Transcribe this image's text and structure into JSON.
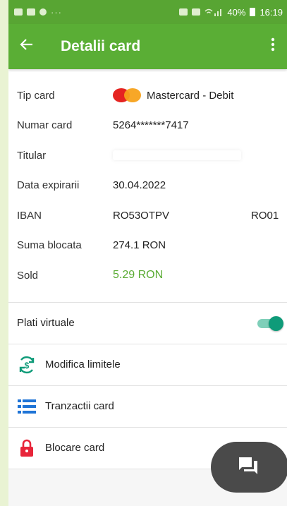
{
  "status_bar": {
    "battery": "40%",
    "time": "16:19",
    "dots": "···"
  },
  "header": {
    "title": "Detalii card",
    "back_icon": "arrow-left-icon",
    "more_icon": "more-vert-icon"
  },
  "card_details": {
    "type_label": "Tip card",
    "type_value": "Mastercard - Debit",
    "number_label": "Numar card",
    "number_value": "5264*******7417",
    "holder_label": "Titular",
    "expiry_label": "Data expirarii",
    "expiry_value": "30.04.2022",
    "iban_label": "IBAN",
    "iban_prefix": "RO53OTPV",
    "iban_suffix": "RO01",
    "blocked_label": "Suma blocata",
    "blocked_value": "274.1 RON",
    "balance_label": "Sold",
    "balance_value": "5.29 RON"
  },
  "actions": {
    "virtual_payments_label": "Plati virtuale",
    "virtual_payments_enabled": true,
    "modify_limits_label": "Modifica limitele",
    "transactions_label": "Tranzactii card",
    "block_card_label": "Blocare card"
  },
  "colors": {
    "brand_green": "#5aae35",
    "balance_green": "#59ab32",
    "toggle_teal": "#0f9b79",
    "list_icon_blue": "#1f74d6",
    "lock_red": "#e8253a",
    "fab_dark": "#4a4a4a"
  },
  "fab": {
    "icon": "chat-bubble-icon"
  }
}
